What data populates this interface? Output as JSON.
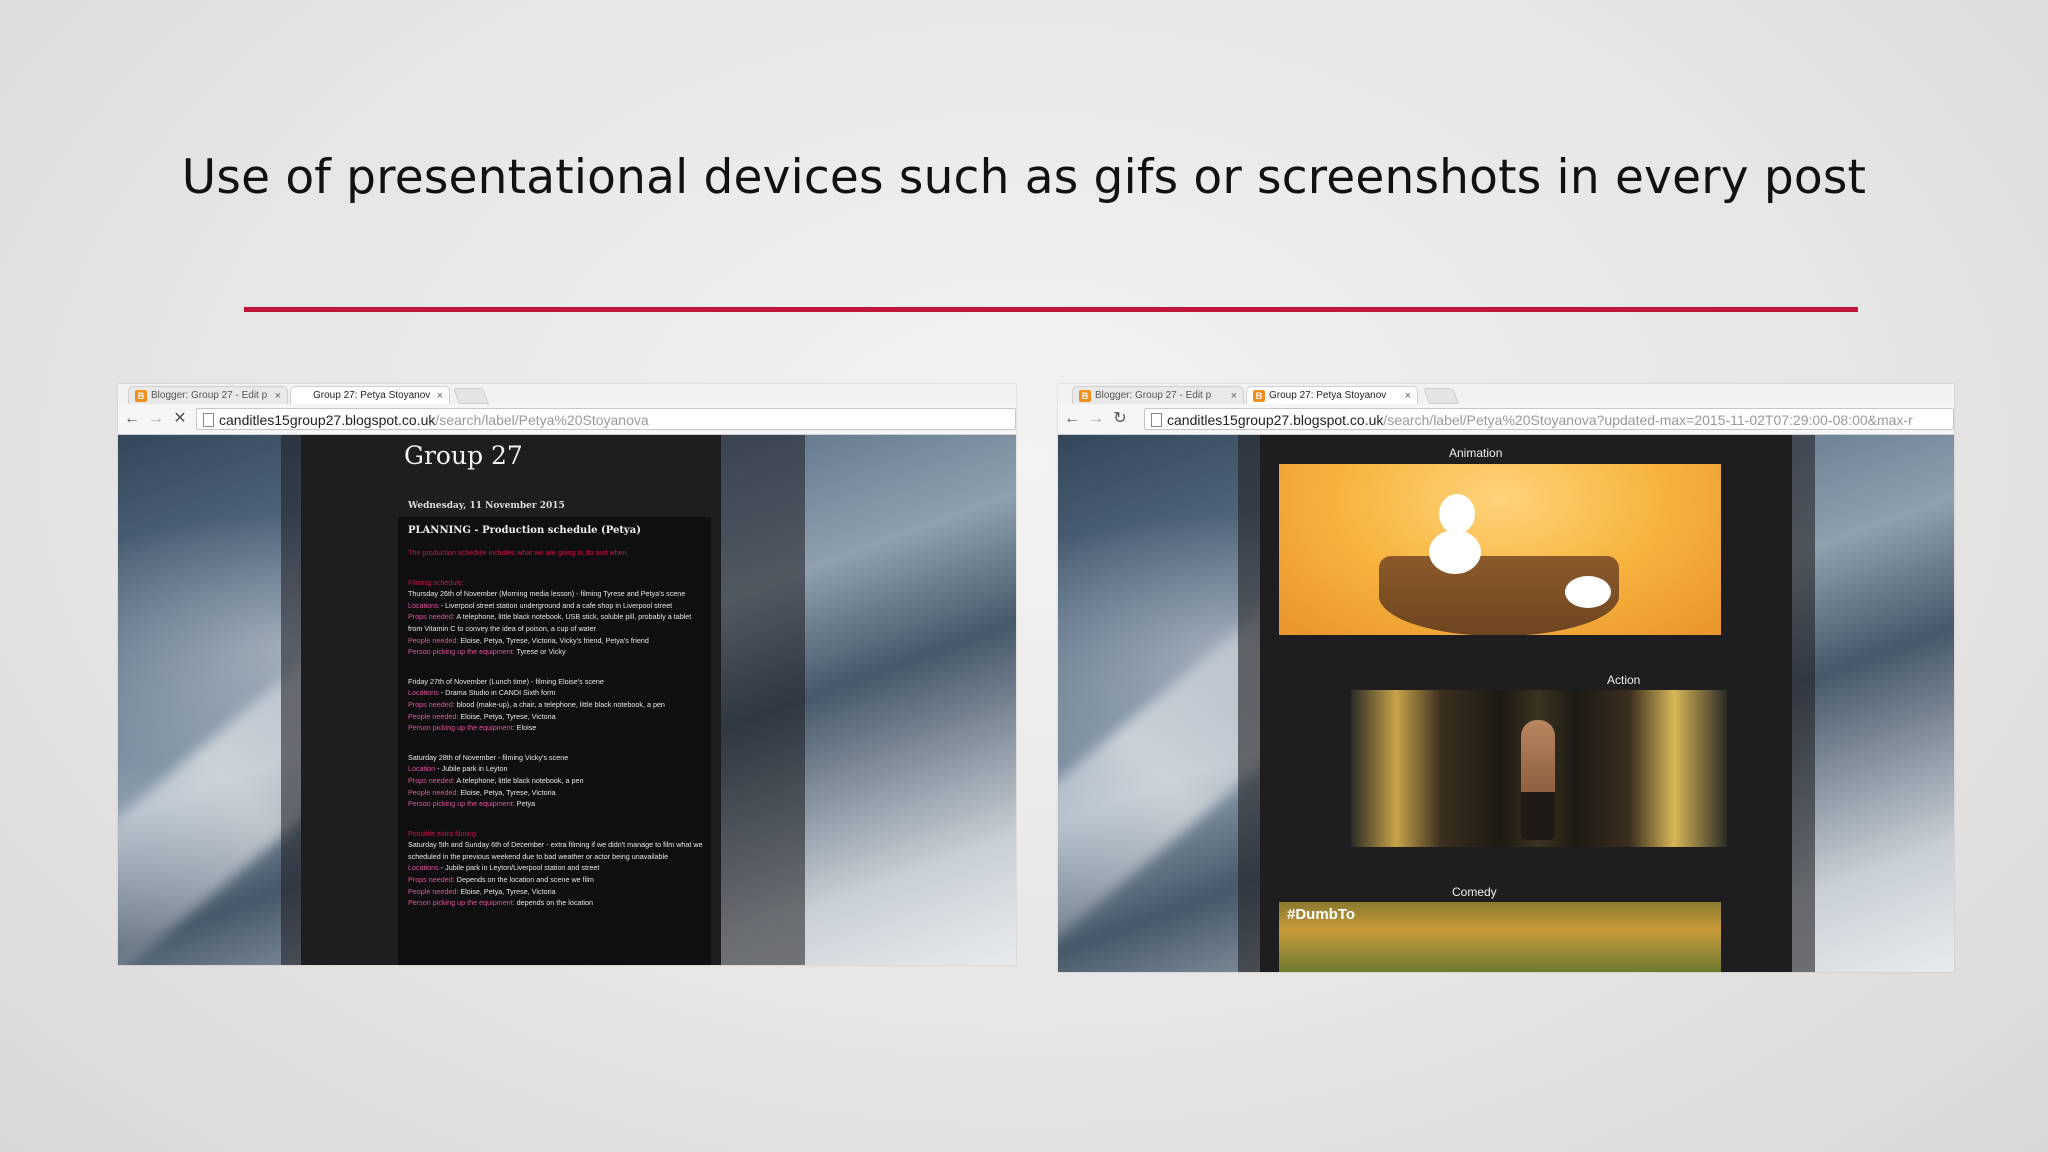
{
  "slide": {
    "title": "Use of presentational devices such as gifs or screenshots in every post"
  },
  "left_browser": {
    "tabs": [
      {
        "label": "Blogger: Group 27 - Edit p",
        "active": false
      },
      {
        "label": "Group 27: Petya Stoyanov",
        "active": true
      }
    ],
    "url_host": "canditles15group27.blogspot.co.uk",
    "url_path": "/search/label/Petya%20Stoyanova",
    "blog": {
      "title": "Group 27",
      "date": "Wednesday, 11 November 2015",
      "post_title": "PLANNING - Production schedule (Petya)",
      "intro": "The production schedule includes what we are going to do and when.",
      "blocks": [
        {
          "heading": "Filming schedule:",
          "lines": [
            {
              "k": "",
              "v": "Thursday 26th of November (Morning media lesson) - filming Tyrese and Petya's scene"
            },
            {
              "k": "Locations",
              "v": " - Liverpool street station underground and a cafe shop in Liverpool street"
            },
            {
              "k": "Props needed:",
              "v": " A telephone, little black notebook, USB stick, soluble pill, probably a tablet from Vitamin C to convey the idea of poison, a cup of water"
            },
            {
              "k": "People needed:",
              "v": " Eloise, Petya, Tyrese, Victoria, Vicky's friend, Petya's friend"
            },
            {
              "k": "Person picking up the equipment:",
              "v": " Tyrese or Vicky"
            }
          ]
        },
        {
          "heading": "",
          "lines": [
            {
              "k": "",
              "v": "Friday 27th of November (Lunch time) - filming Eloise's scene"
            },
            {
              "k": "Locations",
              "v": " - Drama Studio in CANDI Sixth form"
            },
            {
              "k": "Props needed:",
              "v": " blood (make-up), a chair, a telephone, little black notebook, a pen"
            },
            {
              "k": "People needed:",
              "v": " Eloise, Petya, Tyrese, Victoria"
            },
            {
              "k": "Person picking up the equipment:",
              "v": " Eloise"
            }
          ]
        },
        {
          "heading": "",
          "lines": [
            {
              "k": "",
              "v": "Saturday 28th of November - filming Vicky's scene"
            },
            {
              "k": "Location",
              "v": " - Jubile park in Leyton"
            },
            {
              "k": "Props needed:",
              "v": " A telephone, little black notebook, a pen"
            },
            {
              "k": "People needed:",
              "v": " Eloise, Petya, Tyrese, Victoria"
            },
            {
              "k": "Person picking up the equipment:",
              "v": " Petya"
            }
          ]
        },
        {
          "heading": "Possible extra filming:",
          "lines": [
            {
              "k": "",
              "v": "Saturday 5th and Sunday 6th of December - extra filming if we didn't manage to film what we scheduled in the previous weekend due to bad weather or actor being unavailable"
            },
            {
              "k": "Locations",
              "v": " - Jubile park in Leyton/Liverpool station and street"
            },
            {
              "k": "Props needed:",
              "v": " Depends on the location and scene we film"
            },
            {
              "k": "People needed:",
              "v": " Eloise, Petya, Tyrese, Victoria"
            },
            {
              "k": "Person picking up the equipment:",
              "v": " depends on the location"
            }
          ]
        }
      ]
    }
  },
  "right_browser": {
    "tabs": [
      {
        "label": "Blogger: Group 27 - Edit p",
        "active": false
      },
      {
        "label": "Group 27: Petya Stoyanov",
        "active": true
      }
    ],
    "url_host": "canditles15group27.blogspot.co.uk",
    "url_path": "/search/label/Petya%20Stoyanova?updated-max=2015-11-02T07:29:00-08:00&max-r",
    "blog": {
      "sections": [
        {
          "label": "Animation"
        },
        {
          "label": "Action"
        },
        {
          "label": "Comedy"
        }
      ],
      "comedy_hashtag": "#DumbTo"
    }
  },
  "colors": {
    "accent_rule": "#c0163c",
    "blog_bg": "#1e1e21",
    "label_pink": "#e0539b"
  }
}
